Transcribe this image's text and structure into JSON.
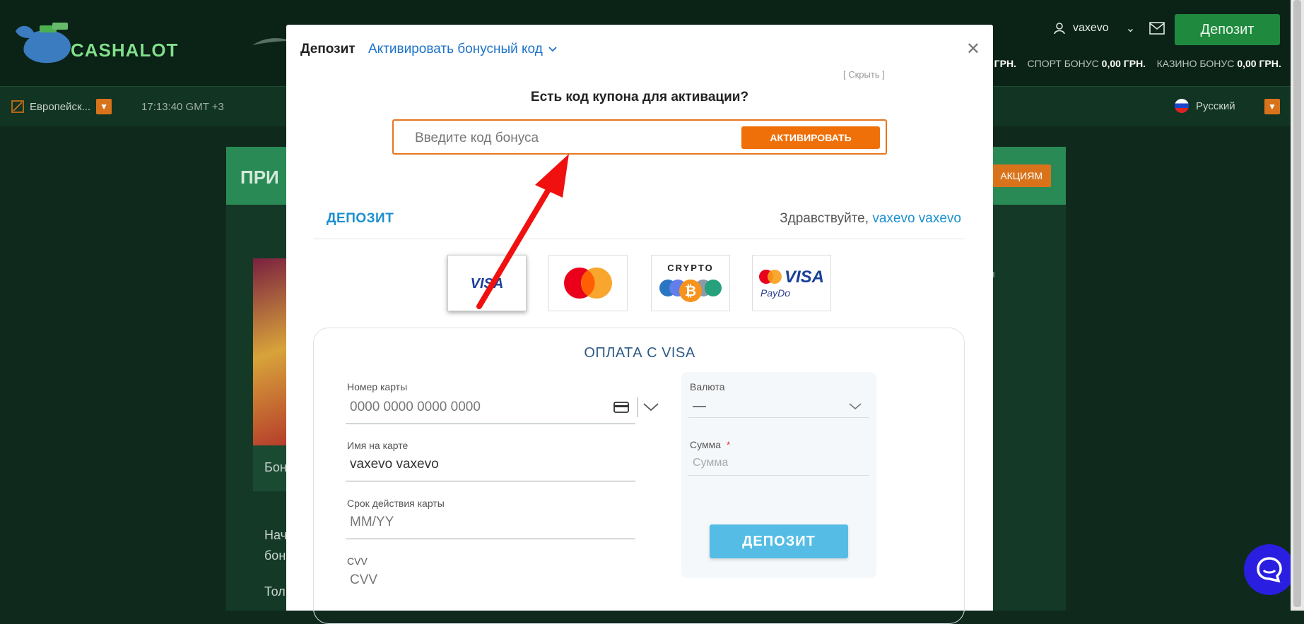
{
  "site": {
    "logo_text": "CASHALOT",
    "username": "vaxevo",
    "top_deposit_button": "Депозит",
    "balance_tail": "0 ГРН.",
    "sport_bonus_label": "СПОРТ БОНУС",
    "sport_bonus_value": "0,00 ГРН.",
    "casino_bonus_label": "КАЗИНО БОНУС",
    "casino_bonus_value": "0,00 ГРН.",
    "odds_format": "Европейск...",
    "clock": "17:13:40 GMT +3",
    "language": "Русский",
    "promo_title_partial": "ПРИ",
    "promo_button_partial": "АКЦИЯМ",
    "bg_text_1": "Бон",
    "bg_text_2": "Нач",
    "bg_text_3": "бон",
    "bg_text_4": "Тол",
    "side_text": "ты"
  },
  "modal": {
    "title": "Депозит",
    "bonus_toggle": "Активировать бонусный код",
    "hide_link": "[ Скрыть ]",
    "coupon_question": "Есть код купона для активации?",
    "coupon_placeholder": "Введите код бонуса",
    "activate_button": "АКТИВИРОВАТЬ",
    "deposit_tab": "ДЕПОЗИТ",
    "greeting": "Здравствуйте,",
    "greeting_name": "vaxevo vaxevo",
    "payment_methods": [
      {
        "name": "VISA",
        "selected": true
      },
      {
        "name": "Mastercard",
        "selected": false
      },
      {
        "name": "CRYPTO",
        "selected": false
      },
      {
        "name": "VISA PayDo",
        "selected": false
      }
    ],
    "pay_title": "ОПЛАТА С VISA",
    "card_number_label": "Номер карты",
    "card_number_placeholder": "0000 0000 0000 0000",
    "card_name_label": "Имя на карте",
    "card_name_value": "vaxevo vaxevo",
    "expiry_label": "Срок действия карты",
    "expiry_placeholder": "MM/YY",
    "cvv_label": "CVV",
    "cvv_placeholder": "CVV",
    "currency_label": "Валюта",
    "currency_value": "—",
    "amount_label": "Сумма",
    "amount_required": "*",
    "amount_placeholder": "Сумма",
    "deposit_button": "ДЕПОЗИТ"
  },
  "colors": {
    "accent_orange": "#ef7009",
    "link_blue": "#1d73c9",
    "deposit_blue": "#55bde5",
    "annotation_arrow": "#f01010"
  }
}
